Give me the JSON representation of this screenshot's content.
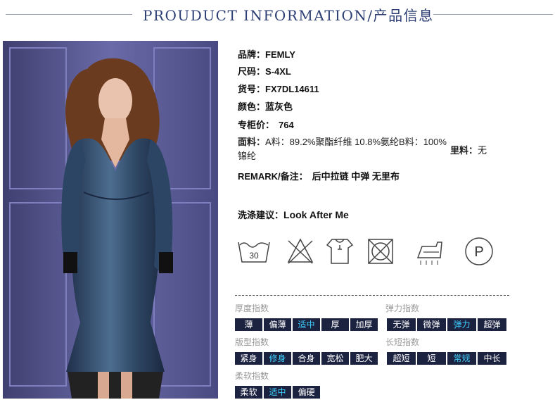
{
  "header": {
    "title": "PROUDUCT INFORMATION/产品信息"
  },
  "product": {
    "brand_label": "品牌：",
    "brand": "FEMLY",
    "size_label": "尺码：",
    "size": "S-4XL",
    "sku_label": "货号：",
    "sku": "FX7DL14611",
    "color_label": "颜色：",
    "color": "蓝灰色",
    "price_label": "专柜价：",
    "price": "764",
    "fabric_label": "面料：",
    "fabric": "A料：89.2%聚酯纤维 10.8%氨纶B料：100%锦纶",
    "lining_label": "里料：",
    "lining": "无",
    "remark_label": "REMARK/备注：",
    "remark": "后中拉链 中弹 无里布",
    "wash_label": "洗涤建议：",
    "wash": "Look After Me"
  },
  "care_icons": [
    "wash-30-icon",
    "no-bleach-icon",
    "hang-dry-icon",
    "no-tumble-dry-icon",
    "iron-icon",
    "dry-clean-p-icon"
  ],
  "care": {
    "wash_temp": "30",
    "dry_clean": "P"
  },
  "indices": {
    "thickness": {
      "label": "厚度指数",
      "options": [
        "薄",
        "偏薄",
        "适中",
        "厚",
        "加厚"
      ],
      "selected": "适中"
    },
    "elasticity": {
      "label": "弹力指数",
      "options": [
        "无弹",
        "微弹",
        "弹力",
        "超弹"
      ],
      "selected": "弹力"
    },
    "fit": {
      "label": "版型指数",
      "options": [
        "紧身",
        "修身",
        "合身",
        "宽松",
        "肥大"
      ],
      "selected": "修身"
    },
    "length": {
      "label": "长短指数",
      "options": [
        "超短",
        "短",
        "常规",
        "中长"
      ],
      "selected": "常规"
    },
    "softness": {
      "label": "柔软指数",
      "options": [
        "柔软",
        "适中",
        "偏硬"
      ],
      "selected": "适中"
    }
  },
  "colors": {
    "accent": "#2c3e74",
    "tag_bg": "#1c2340",
    "tag_selected": "#3fd0ff",
    "label_gray": "#999999"
  }
}
